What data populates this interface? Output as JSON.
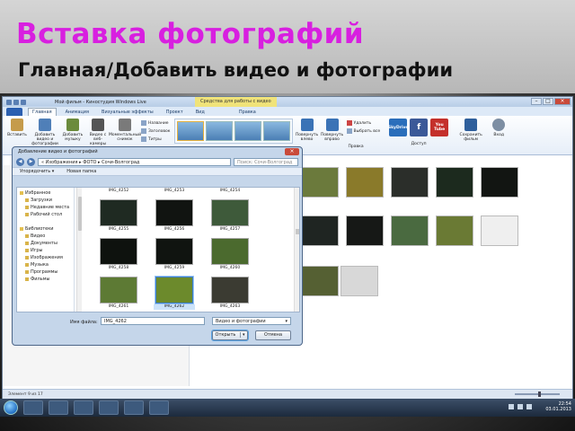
{
  "slide": {
    "title": "Вставка фотографий",
    "subtitle": "Главная/Добавить видео и фотографии"
  },
  "app": {
    "window_title": "Мой фильм - Киностудия Windows Live",
    "contextual_tab": "Средства для работы с видео",
    "tabs": [
      "Главная",
      "Анимация",
      "Визуальные эффекты",
      "Проект",
      "Вид",
      "Правка"
    ],
    "active_tab": "Главная",
    "ribbon": {
      "paste": "Вставить",
      "add_media": "Добавить видео и фотографии",
      "add_music": "Добавить музыку",
      "webcam": "Видео с веб-камеры",
      "snapshot": "Моментальный снимок",
      "title": "Название",
      "caption": "Заголовок",
      "credits": "Титры",
      "rotate_left": "Повернуть влево",
      "rotate_right": "Повернуть вправо",
      "delete": "Удалить",
      "select_all": "Выбрать все",
      "editing_group": "Правка",
      "sharing_group": "Доступ",
      "save_movie": "Сохранить фильм",
      "sign_in": "Вход",
      "social": [
        "SkyDrive",
        "f",
        "You Tube"
      ]
    },
    "status": "Элемент 9 из 17",
    "brand_colors": {
      "facebook": "#3b5998",
      "youtube": "#c4302b",
      "skydrive": "#2a6ebb"
    }
  },
  "dialog": {
    "title": "Добавление видео и фотографий",
    "breadcrumb": "« Изображения ▸ ФОТО ▸ Сочи-Волгоград",
    "search_placeholder": "Поиск: Сочи-Волгоград",
    "toolbar": {
      "organize": "Упорядочить ▾",
      "new_folder": "Новая папка"
    },
    "nav": [
      {
        "label": "Избранное",
        "level": 0
      },
      {
        "label": "Загрузки",
        "level": 1
      },
      {
        "label": "Недавние места",
        "level": 1
      },
      {
        "label": "Рабочий стол",
        "level": 1
      },
      {
        "label": "",
        "level": 1
      },
      {
        "label": "Библиотеки",
        "level": 0
      },
      {
        "label": "Видео",
        "level": 1
      },
      {
        "label": "Документы",
        "level": 1
      },
      {
        "label": "Игры",
        "level": 1
      },
      {
        "label": "Изображения",
        "level": 1
      },
      {
        "label": "Музыка",
        "level": 1
      },
      {
        "label": "Программы",
        "level": 1
      },
      {
        "label": "Фильмы",
        "level": 1
      }
    ],
    "files": [
      {
        "name": "IMG_4252",
        "color": "#1a1e1a",
        "selected": false
      },
      {
        "name": "IMG_4253",
        "color": "#151815",
        "selected": false
      },
      {
        "name": "IMG_4254",
        "color": "#2d372c",
        "selected": false
      },
      {
        "name": "IMG_4255",
        "color": "#1f2a22",
        "selected": false
      },
      {
        "name": "IMG_4256",
        "color": "#111411",
        "selected": false
      },
      {
        "name": "IMG_4257",
        "color": "#3e5a3a",
        "selected": false
      },
      {
        "name": "IMG_4258",
        "color": "#0e120e",
        "selected": false
      },
      {
        "name": "IMG_4259",
        "color": "#101410",
        "selected": false
      },
      {
        "name": "IMG_4260",
        "color": "#4b6a2e",
        "selected": false
      },
      {
        "name": "IMG_4261",
        "color": "#5d7a34",
        "selected": false
      },
      {
        "name": "IMG_4262",
        "color": "#6c8a2c",
        "selected": true
      },
      {
        "name": "IMG_4263",
        "color": "#3b3b32",
        "selected": false
      }
    ],
    "filename_label": "Имя файла:",
    "filename_value": "IMG_4262",
    "filetype_value": "Видео и фотографии",
    "open_button": "Открыть",
    "cancel_button": "Отмена"
  },
  "storyboard_colors": [
    "#6b7a3c",
    "#8a7a2a",
    "#2b2e2a",
    "#1c2a1e",
    "#121512",
    "#1f2522",
    "#161816",
    "#4a6a40",
    "#6a7a34",
    "#efefef",
    "#556033",
    "#d8d8d8"
  ],
  "taskbar": {
    "time": "22:54",
    "date": "03.01.2013"
  }
}
